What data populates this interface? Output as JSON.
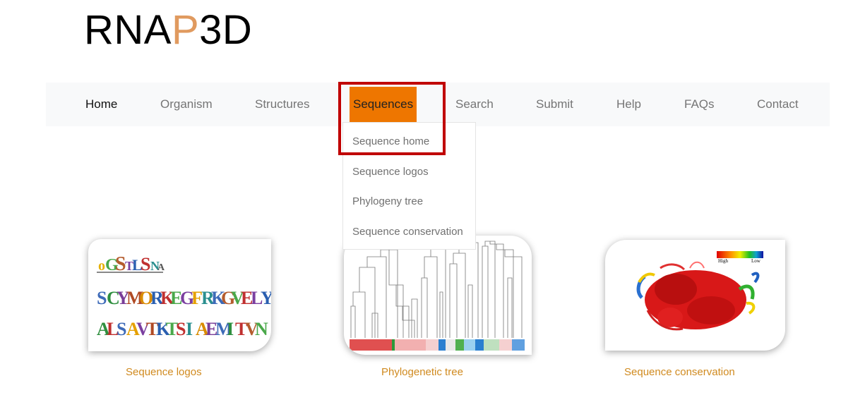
{
  "logo": {
    "part1": "RNA",
    "part2": "P",
    "part3": "3D"
  },
  "nav": {
    "items": [
      "Home",
      "Organism",
      "Structures",
      "Sequences",
      "Search",
      "Submit",
      "Help",
      "FAQs",
      "Contact"
    ]
  },
  "dropdown": {
    "items": [
      "Sequence home",
      "Sequence logos",
      "Phylogeny tree",
      "Sequence conservation"
    ]
  },
  "cards": [
    {
      "caption": "Sequence logos"
    },
    {
      "caption": "Phylogenetic tree"
    },
    {
      "caption": "Sequence conservation",
      "legend_high": "High",
      "legend_low": "Low"
    }
  ],
  "colors": {
    "accent": "#ee7600",
    "highlight_border": "#c00000",
    "caption": "#d08a1f",
    "navbar_bg": "#f8f9fa"
  }
}
